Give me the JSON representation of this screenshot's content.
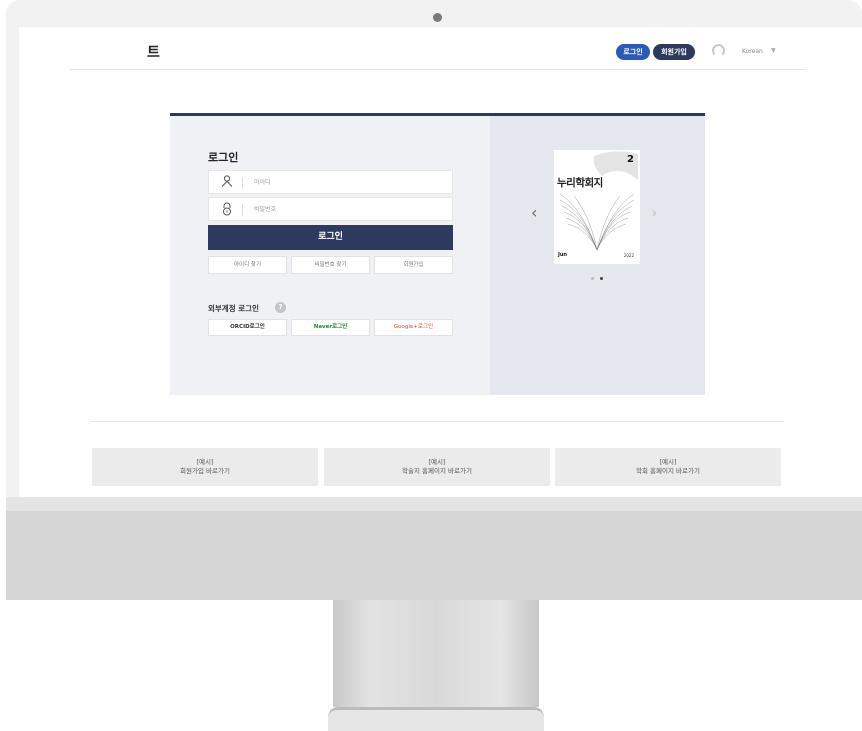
{
  "header": {
    "logo_text": "트",
    "login_label": "로그인",
    "join_label": "회원가입",
    "language": "Korean",
    "language_caret": "▼"
  },
  "login": {
    "title": "로그인",
    "id_placeholder": "아이디",
    "pw_placeholder": "비밀번호",
    "submit_label": "로그인",
    "find_id_label": "아이디 찾기",
    "find_pw_label": "비밀번호 찾기",
    "signup_label": "회원가입",
    "external_title": "외부계정 로그인",
    "help_mark": "?",
    "orcid_label": "ORCID로그인",
    "naver_label": "Naver로그인",
    "google_label": "Google+로그인"
  },
  "carousel": {
    "prev": "‹",
    "next": "›",
    "cover_number": "2",
    "cover_title": "누리학회지",
    "cover_month": "Jun",
    "cover_year": "2022"
  },
  "shortcuts": [
    {
      "line1": "[예시]",
      "line2": "회원가입 바로가기"
    },
    {
      "line1": "[예시]",
      "line2": "학술지 홈페이지 바로가기"
    },
    {
      "line1": "[예시]",
      "line2": "학회 홈페이지 바로가기"
    }
  ],
  "colors": {
    "brand_navy": "#2d3a5e",
    "login_blue": "#2a5bb8",
    "naver_green": "#1b8a3a",
    "google_red": "#d04a3a"
  },
  "icons": {
    "id_field": "user-icon",
    "pw_field": "lock-icon",
    "support": "headset-icon"
  }
}
